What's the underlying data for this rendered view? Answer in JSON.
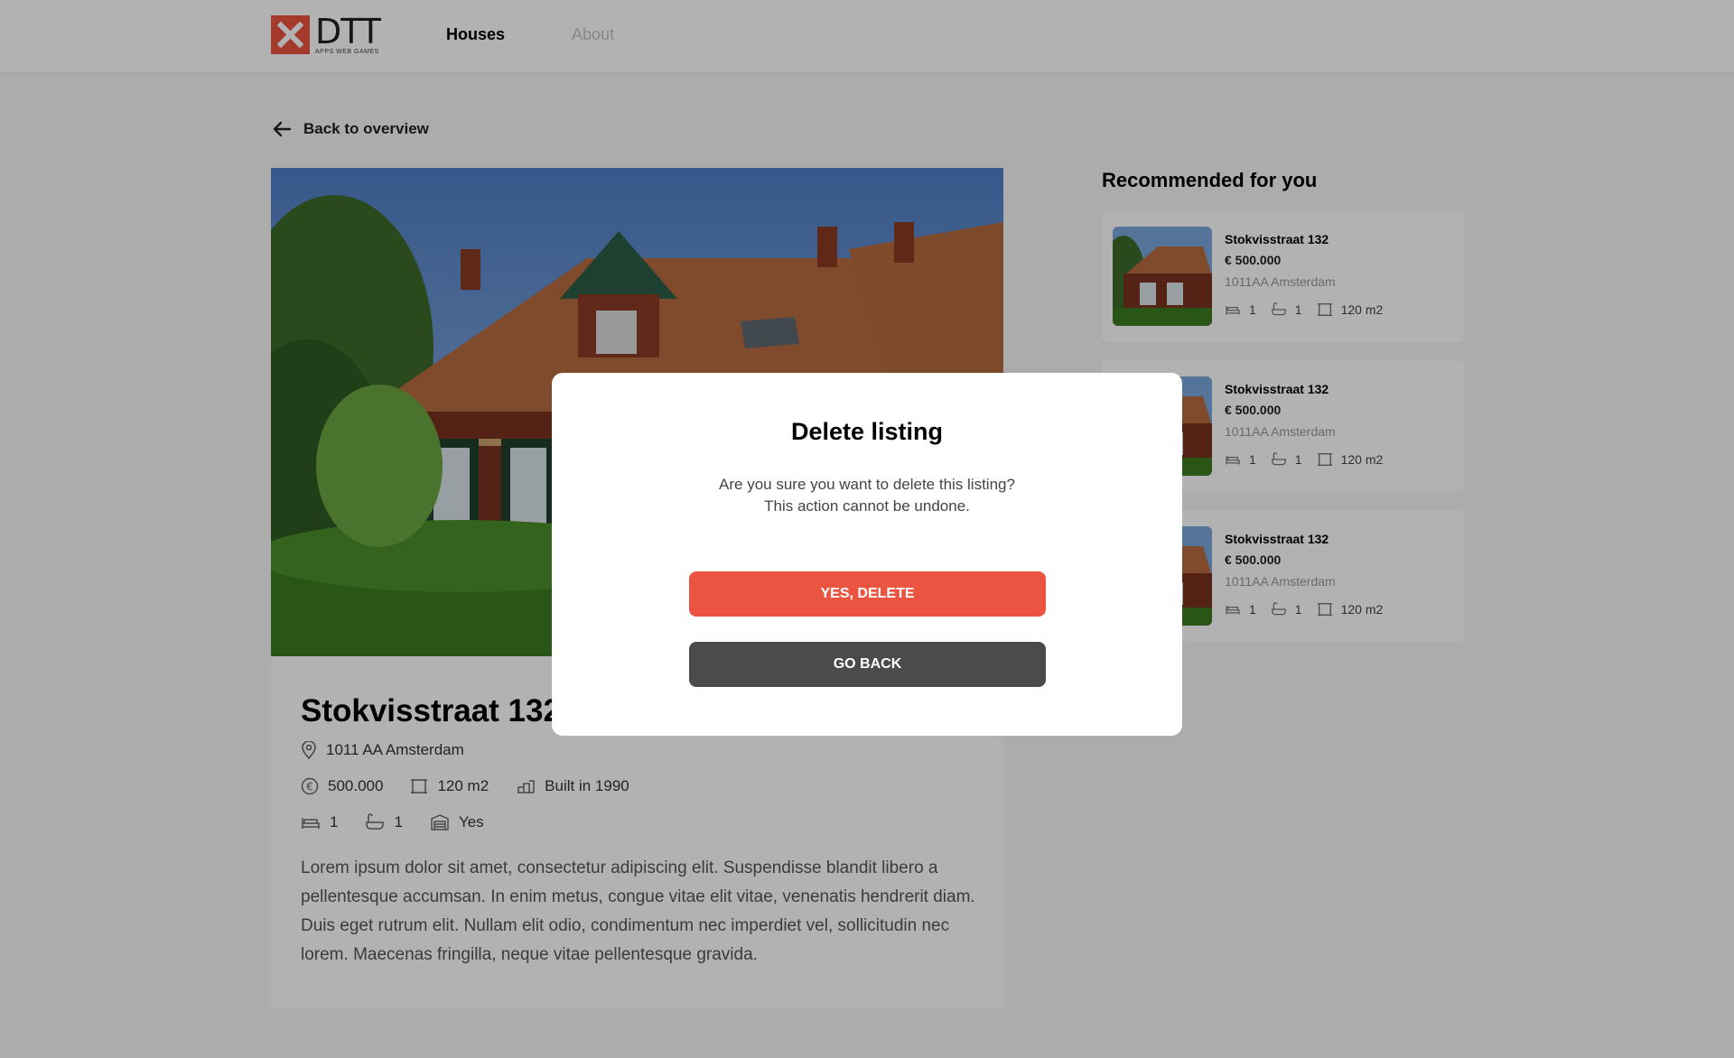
{
  "header": {
    "logo_text": "DTT",
    "logo_subtext": "APPS WEB GAMES",
    "nav": [
      {
        "label": "Houses",
        "active": true
      },
      {
        "label": "About",
        "active": false
      }
    ]
  },
  "back_link": {
    "label": "Back to overview",
    "icon": "arrow-left-icon"
  },
  "listing": {
    "title": "Stokvisstraat 132",
    "address": "1011 AA Amsterdam",
    "price": "500.000",
    "size": "120 m2",
    "built": "Built in 1990",
    "bedrooms": "1",
    "bathrooms": "1",
    "garage": "Yes",
    "description": "Lorem ipsum dolor sit amet, consectetur adipiscing elit. Suspendisse blandit libero a pellentesque accumsan. In enim metus, congue vitae elit vitae, venenatis hendrerit diam. Duis eget rutrum elit. Nullam elit odio, condimentum nec imperdiet vel, sollicitudin nec lorem. Maecenas fringilla, neque vitae pellentesque gravida."
  },
  "recommended": {
    "title": "Recommended for you",
    "items": [
      {
        "name": "Stokvisstraat 132",
        "price": "€ 500.000",
        "address": "1011AA Amsterdam",
        "bedrooms": "1",
        "bathrooms": "1",
        "size": "120 m2"
      },
      {
        "name": "Stokvisstraat 132",
        "price": "€ 500.000",
        "address": "1011AA Amsterdam",
        "bedrooms": "1",
        "bathrooms": "1",
        "size": "120 m2"
      },
      {
        "name": "Stokvisstraat 132",
        "price": "€ 500.000",
        "address": "1011AA Amsterdam",
        "bedrooms": "1",
        "bathrooms": "1",
        "size": "120 m2"
      }
    ]
  },
  "modal": {
    "title": "Delete listing",
    "message_line1": "Are you sure you want to delete this listing?",
    "message_line2": "This action cannot be undone.",
    "confirm_label": "YES, DELETE",
    "cancel_label": "GO BACK"
  },
  "colors": {
    "accent": "#eb5440",
    "dark_button": "#4a4b4c",
    "background": "#f6f6f6"
  }
}
